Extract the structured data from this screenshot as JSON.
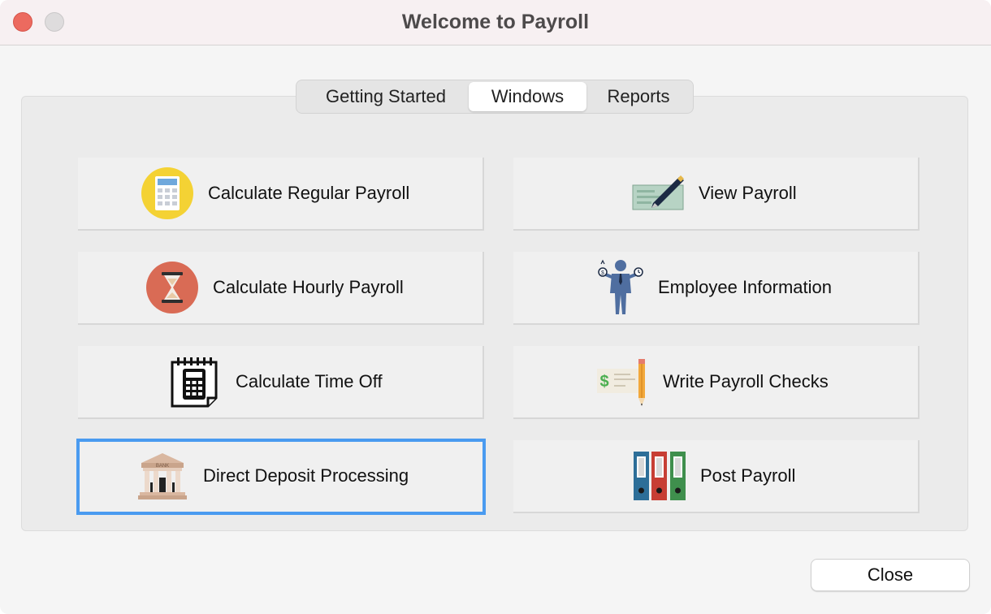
{
  "window": {
    "title": "Welcome to Payroll"
  },
  "tabs": [
    {
      "label": "Getting Started",
      "active": false
    },
    {
      "label": "Windows",
      "active": true
    },
    {
      "label": "Reports",
      "active": false
    }
  ],
  "tiles": {
    "left": [
      {
        "label": "Calculate Regular Payroll",
        "icon": "calculator-icon"
      },
      {
        "label": "Calculate Hourly Payroll",
        "icon": "hourglass-icon"
      },
      {
        "label": "Calculate Time Off",
        "icon": "calendar-calculator-icon"
      },
      {
        "label": "Direct Deposit Processing",
        "icon": "bank-icon",
        "focused": true
      }
    ],
    "right": [
      {
        "label": "View Payroll",
        "icon": "check-pen-icon"
      },
      {
        "label": "Employee Information",
        "icon": "employee-icon"
      },
      {
        "label": "Write Payroll Checks",
        "icon": "check-pencil-icon"
      },
      {
        "label": "Post Payroll",
        "icon": "binders-icon"
      }
    ]
  },
  "bank_sign": "BANK",
  "footer": {
    "close_label": "Close"
  },
  "colors": {
    "accent_focus": "#4a9bf0",
    "close_traffic": "#ec6a5f"
  }
}
